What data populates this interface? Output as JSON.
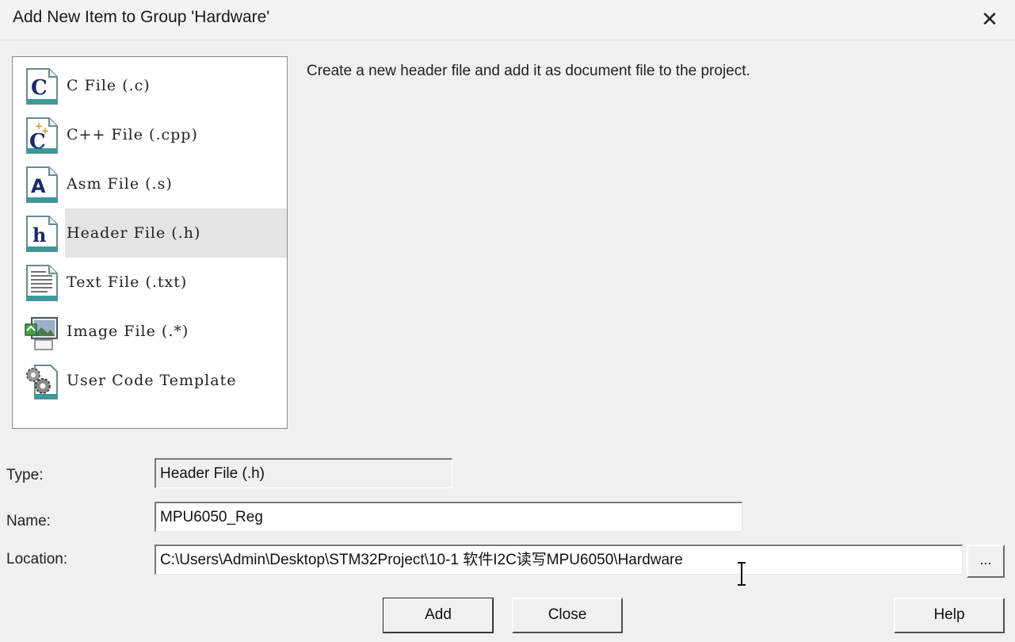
{
  "window": {
    "title": "Add New Item to Group 'Hardware'",
    "close_icon": "close-icon"
  },
  "item_list": {
    "items": [
      {
        "label": "C File (.c)",
        "icon": "c-file-icon",
        "glyph": "C",
        "selected": false
      },
      {
        "label": "C++ File (.cpp)",
        "icon": "cpp-file-icon",
        "glyph": "C",
        "selected": false
      },
      {
        "label": "Asm File (.s)",
        "icon": "asm-file-icon",
        "glyph": "A",
        "selected": false
      },
      {
        "label": "Header File (.h)",
        "icon": "header-file-icon",
        "glyph": "h",
        "selected": true
      },
      {
        "label": "Text File (.txt)",
        "icon": "text-file-icon",
        "glyph": "",
        "selected": false
      },
      {
        "label": "Image File (.*)",
        "icon": "image-file-icon",
        "glyph": "",
        "selected": false
      },
      {
        "label": "User Code Template",
        "icon": "user-code-template-icon",
        "glyph": "",
        "selected": false
      }
    ]
  },
  "description": "Create a new header file and add it as document file to the project.",
  "form": {
    "type_label": "Type:",
    "type_value": "Header File (.h)",
    "name_label": "Name:",
    "name_value": "MPU6050_Reg",
    "location_label": "Location:",
    "location_value": "C:\\Users\\Admin\\Desktop\\STM32Project\\10-1 软件I2C读写MPU6050\\Hardware",
    "browse_label": "..."
  },
  "buttons": {
    "add": "Add",
    "close": "Close",
    "help": "Help"
  },
  "colors": {
    "dialog_bg": "#f0f0f0",
    "selected_row": "#e4e4e4",
    "icon_navy": "#1a2a6c",
    "icon_teal": "#2a8a8a"
  }
}
